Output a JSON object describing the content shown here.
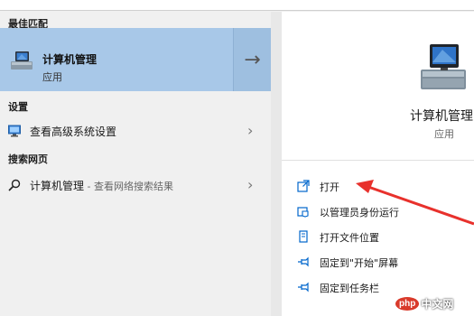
{
  "left": {
    "best_match_header": "最佳匹配",
    "best_match": {
      "title": "计算机管理",
      "subtitle": "应用",
      "arrow_icon": "arrow-right-icon"
    },
    "settings_header": "设置",
    "settings_item": {
      "label": "查看高级系统设置",
      "icon": "monitor-settings-icon"
    },
    "web_header": "搜索网页",
    "web_item": {
      "label": "计算机管理",
      "hint": " - 查看网络搜索结果",
      "icon": "search-icon"
    }
  },
  "right": {
    "app_title": "计算机管理",
    "app_subtitle": "应用",
    "actions": [
      {
        "label": "打开",
        "icon": "open-icon"
      },
      {
        "label": "以管理员身份运行",
        "icon": "run-as-admin-icon"
      },
      {
        "label": "打开文件位置",
        "icon": "file-location-icon"
      },
      {
        "label": "固定到\"开始\"屏幕",
        "icon": "pin-icon"
      },
      {
        "label": "固定到任务栏",
        "icon": "pin-icon"
      }
    ]
  },
  "watermark": {
    "logo": "php",
    "text": "中文网"
  },
  "colors": {
    "selection": "#a8c8e8",
    "accent": "#0066cc",
    "annotation_arrow": "#e8312c"
  }
}
